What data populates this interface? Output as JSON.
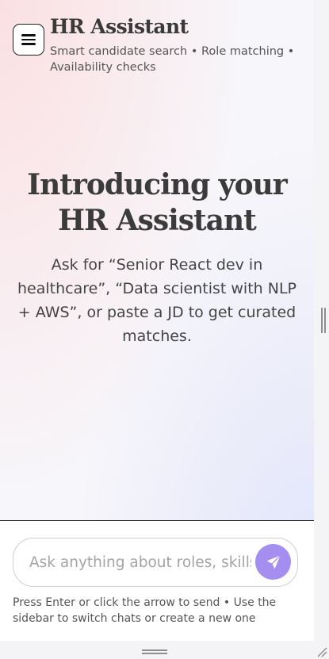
{
  "header": {
    "title": "HR Assistant",
    "subtitle": "Smart candidate search • Role matching • Availability checks",
    "menu_icon": "hamburger-menu-icon"
  },
  "hero": {
    "title": "Introducing your HR Assistant",
    "description": "Ask for “Senior React dev in healthcare”, “Data scientist with NLP + AWS”, or paste a JD to get curated matches."
  },
  "composer": {
    "placeholder": "Ask anything about roles, skills, availability...",
    "value": "",
    "send_icon": "paper-plane-send-icon",
    "hint": "Press Enter or click the arrow to send • Use the sidebar to switch chats or create a new one"
  },
  "colors": {
    "accent": "#a48ef0",
    "title_text": "#3a3a3a",
    "gradient_pink": "#fbe0e2",
    "gradient_blue": "#dfe3fb"
  }
}
